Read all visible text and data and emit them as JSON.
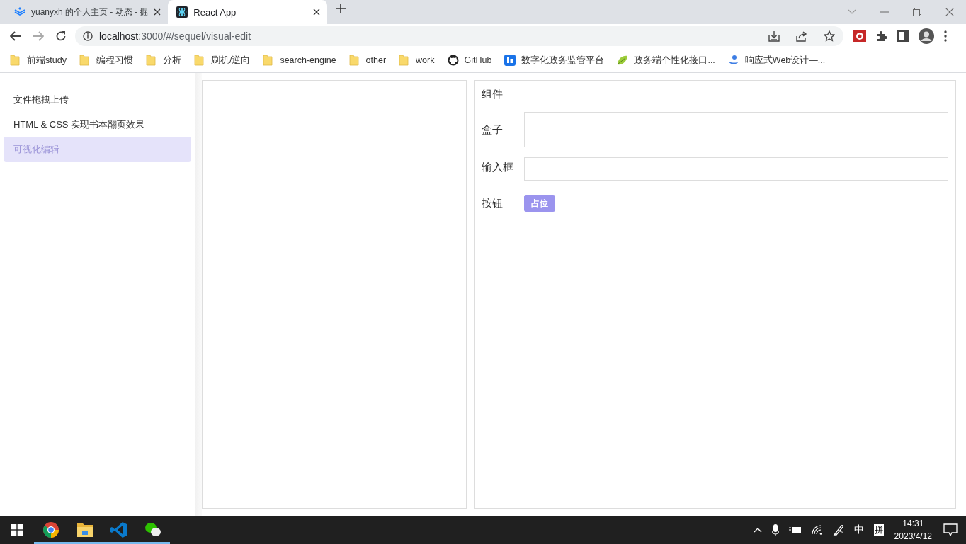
{
  "browser": {
    "tabs": [
      {
        "title": "yuanyxh 的个人主页 - 动态 - 掘",
        "selected": false,
        "kind": "layers"
      },
      {
        "title": "React App",
        "selected": true,
        "kind": "atom"
      }
    ],
    "address": {
      "host": "localhost",
      "rest": ":3000/#/sequel/visual-edit"
    },
    "bookmarks": [
      {
        "label": "前端study",
        "kind": "folder"
      },
      {
        "label": "编程习惯",
        "kind": "folder"
      },
      {
        "label": "分析",
        "kind": "folder"
      },
      {
        "label": "刷机/逆向",
        "kind": "folder"
      },
      {
        "label": "search-engine",
        "kind": "folder"
      },
      {
        "label": "other",
        "kind": "folder"
      },
      {
        "label": "work",
        "kind": "folder"
      },
      {
        "label": "GitHub",
        "kind": "github"
      },
      {
        "label": "数字化政务监管平台",
        "kind": "app"
      },
      {
        "label": "政务端个性化接口...",
        "kind": "leaf"
      },
      {
        "label": "响应式Web设计—...",
        "kind": "drop"
      }
    ]
  },
  "sidebar": {
    "items": [
      {
        "label": "文件拖拽上传",
        "selected": false
      },
      {
        "label": "HTML & CSS 实现书本翻页效果",
        "selected": false
      },
      {
        "label": "可视化编辑",
        "selected": true
      }
    ]
  },
  "components": {
    "title": "组件",
    "items": [
      {
        "label": "盒子",
        "kind": "box"
      },
      {
        "label": "输入框",
        "kind": "input"
      },
      {
        "label": "按钮",
        "kind": "button",
        "button_text": "占位"
      }
    ]
  },
  "taskbar": {
    "apps": [
      {
        "kind": "chrome",
        "running": true
      },
      {
        "kind": "files",
        "running": true
      },
      {
        "kind": "code",
        "running": true
      },
      {
        "kind": "chat",
        "running": true
      }
    ],
    "tray": [
      "中",
      "拼"
    ],
    "time": "14:31",
    "date": "2023/4/12"
  }
}
